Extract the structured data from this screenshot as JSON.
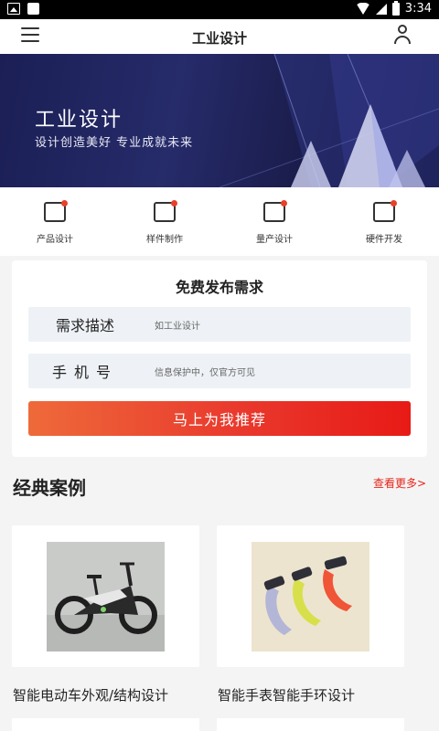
{
  "status_bar": {
    "time": "3:34"
  },
  "header": {
    "title": "工业设计"
  },
  "banner": {
    "title": "工业设计",
    "subtitle": "设计创造美好   专业成就未来"
  },
  "categories": [
    {
      "label": "产品设计",
      "icon": "product-design-icon"
    },
    {
      "label": "样件制作",
      "icon": "sample-making-icon"
    },
    {
      "label": "量产设计",
      "icon": "mass-production-icon"
    },
    {
      "label": "硬件开发",
      "icon": "hardware-dev-icon"
    }
  ],
  "form": {
    "title": "免费发布需求",
    "fields": [
      {
        "label": "需求描述",
        "placeholder": "如工业设计"
      },
      {
        "label": "手机号",
        "placeholder": "信息保护中，仅官方可见"
      }
    ],
    "submit_label": "马上为我推荐"
  },
  "cases_section": {
    "title": "经典案例",
    "more_label": "查看更多>",
    "items": [
      {
        "label": "智能电动车外观/结构设计"
      },
      {
        "label": "智能手表智能手环设计"
      }
    ]
  },
  "colors": {
    "accent": "#e8241a",
    "banner_bg": "#1f2360",
    "field_bg": "#eef2f6"
  }
}
